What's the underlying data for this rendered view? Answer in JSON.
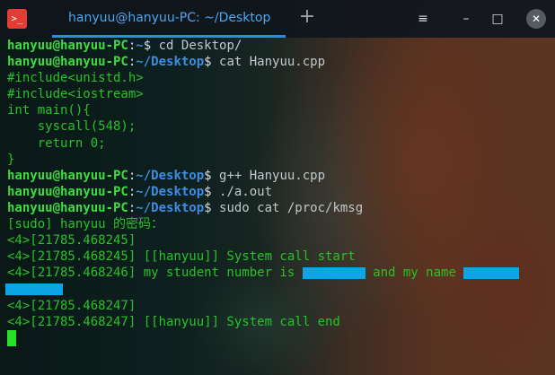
{
  "titlebar": {
    "tab_title": "hanyuu@hanyuu-PC: ~/Desktop",
    "app_icon": ">_",
    "new_tab_symbol": "+"
  },
  "window_controls": {
    "menu_icon": "≡",
    "minimize_icon": "–",
    "maximize_icon": "□",
    "close_icon": "✕"
  },
  "terminal": {
    "prompt_user": "hanyuu@hanyuu-PC",
    "prompt_colon": ":",
    "prompt_home": "~",
    "prompt_desktop": "~/Desktop",
    "prompt_symbol": "$",
    "cmd1": " cd Desktop/",
    "cmd2": " cat Hanyuu.cpp",
    "code1": "#include<unistd.h>",
    "code2": "#include<iostream>",
    "code3": "int main(){",
    "code4": "    syscall(548);",
    "code5": "    return 0;",
    "code6": "}",
    "cmd3": " g++ Hanyuu.cpp",
    "cmd4": " ./a.out",
    "cmd5": " sudo cat /proc/kmsg",
    "out1": "[sudo] hanyuu 的密码：",
    "out2": "<4>[21785.468245]",
    "out3": "<4>[21785.468245] [[hanyuu]] System call start",
    "out4a": "<4>[21785.468246] my student number is ",
    "out4b": " and my name ",
    "out5": "<4>[21785.468247]",
    "out6": "<4>[21785.468247] [[hanyuu]] System call end"
  },
  "colors": {
    "prompt_user": "#3edc3e",
    "prompt_path": "#3b8ee6",
    "output": "#27c227",
    "redaction": "#0aa6e6",
    "tab_title": "#4aa8ef",
    "close_button": "#555b61"
  }
}
